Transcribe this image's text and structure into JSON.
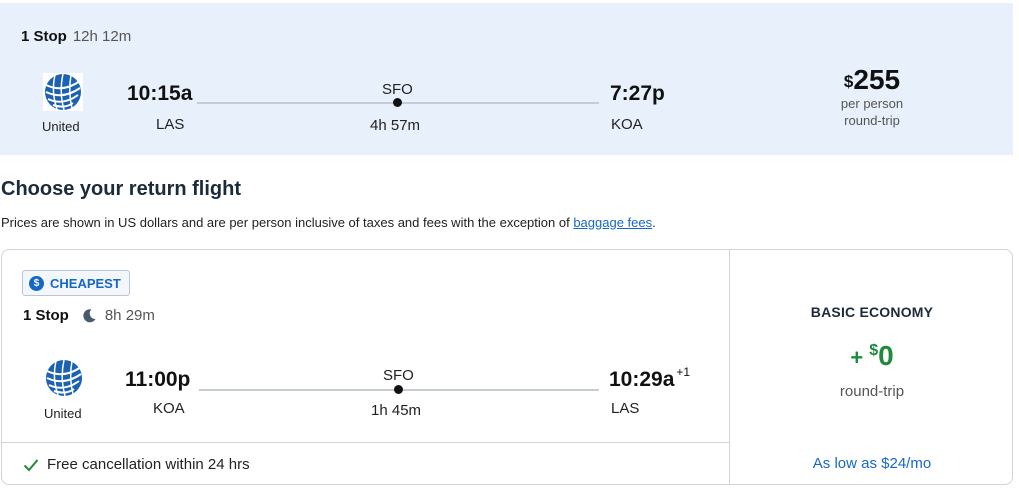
{
  "outbound": {
    "stops": "1 Stop",
    "total_duration": "12h 12m",
    "airline": "United",
    "depart_time": "10:15a",
    "depart_code": "LAS",
    "layover_code": "SFO",
    "segment_duration": "4h 57m",
    "arrive_time": "7:27p",
    "arrive_code": "KOA",
    "price_currency": "$",
    "price": "255",
    "price_line1": "per person",
    "price_line2": "round-trip"
  },
  "heading": "Choose your return flight",
  "notice": {
    "text": "Prices are shown in US dollars and are per person inclusive of taxes and fees with the exception of ",
    "link": "baggage fees",
    "end": "."
  },
  "return_flight": {
    "badge": "CHEAPEST",
    "badge_icon": "$",
    "stops": "1 Stop",
    "total_duration": "8h 29m",
    "airline": "United",
    "depart_time": "11:00p",
    "depart_code": "KOA",
    "layover_code": "SFO",
    "segment_duration": "1h 45m",
    "arrive_time": "10:29a",
    "day_offset": "+1",
    "arrive_code": "LAS",
    "cancellation": "Free cancellation within 24 hrs",
    "fare": {
      "name": "BASIC ECONOMY",
      "plus": "+",
      "currency": "$",
      "amount": "0",
      "sub": "round-trip",
      "monthly": "As low as $24/mo"
    }
  },
  "colors": {
    "outbound_bg": "#e8f0fb",
    "accent_blue": "#1668c4",
    "price_green": "#1f8a3b"
  },
  "icons": [
    "united-globe-logo-icon",
    "dollar-coin-icon",
    "moon-icon",
    "checkmark-icon"
  ]
}
